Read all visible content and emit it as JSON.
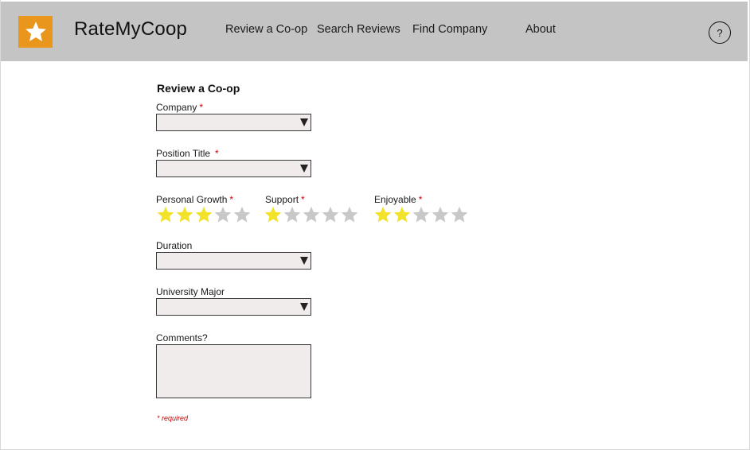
{
  "app": {
    "brand": "RateMyCoop",
    "logo_icon": "star-icon",
    "accent_color": "#e8961c"
  },
  "nav": {
    "items": [
      {
        "label": "Review a Co-op"
      },
      {
        "label": "Search Reviews"
      },
      {
        "label": "Find Company"
      },
      {
        "label": "About"
      }
    ],
    "help_label": "?"
  },
  "form": {
    "title": "Review a Co-op",
    "required_marker": "*",
    "company": {
      "label": "Company",
      "value": ""
    },
    "position_title": {
      "label": "Position Title",
      "value": ""
    },
    "ratings": [
      {
        "label": "Personal Growth",
        "value": 3,
        "max": 5
      },
      {
        "label": "Support",
        "value": 1,
        "max": 5
      },
      {
        "label": "Enjoyable",
        "value": 2,
        "max": 5
      }
    ],
    "duration": {
      "label": "Duration",
      "value": ""
    },
    "university_major": {
      "label": "University Major",
      "value": ""
    },
    "comments": {
      "label": "Comments?",
      "value": ""
    },
    "required_note": "* required",
    "star_filled_color": "#f2e22a",
    "star_empty_color": "#c8c8c8"
  }
}
